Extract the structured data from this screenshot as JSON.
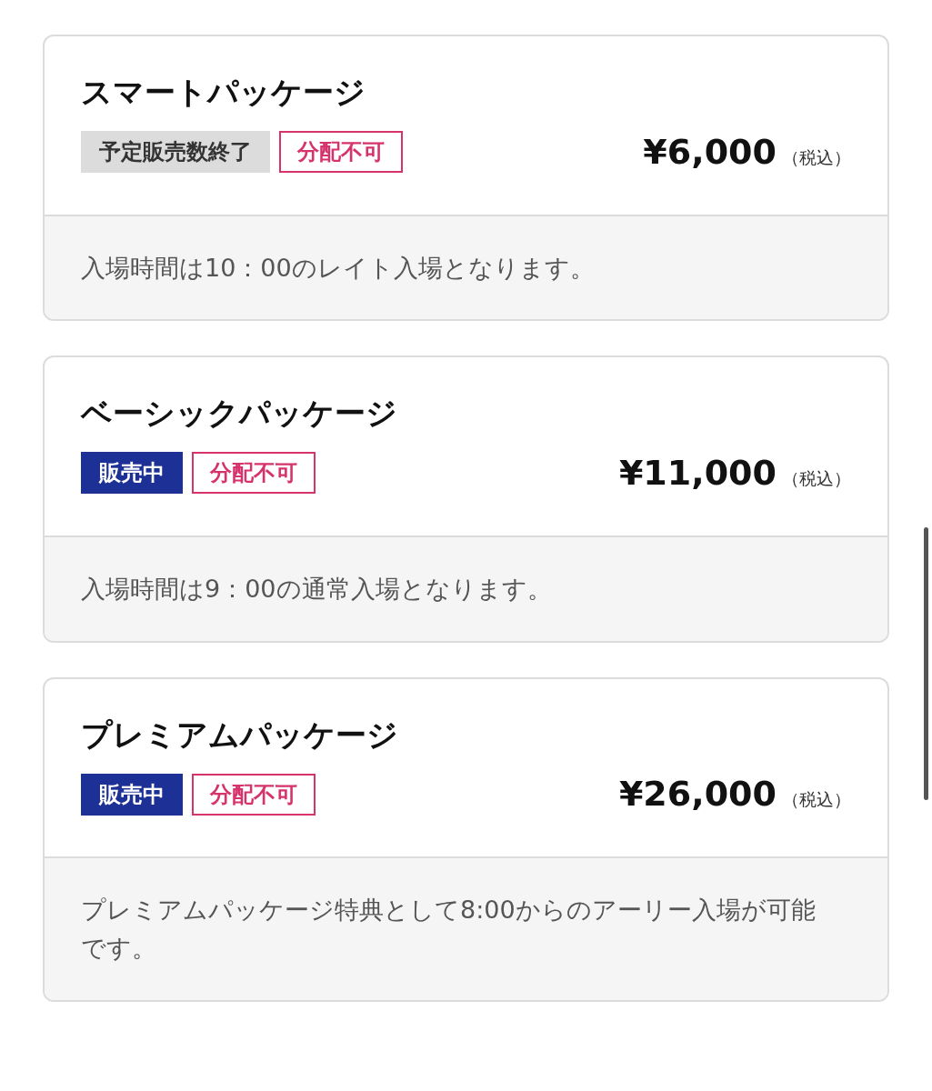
{
  "packages": [
    {
      "name": "スマートパッケージ",
      "badges": [
        {
          "kind": "sold_out",
          "label": "予定販売数終了"
        },
        {
          "kind": "restriction",
          "label": "分配不可"
        }
      ],
      "price": "¥6,000",
      "tax_note": "（税込）",
      "description": "入場時間は10：00のレイト入場となります。"
    },
    {
      "name": "ベーシックパッケージ",
      "badges": [
        {
          "kind": "on_sale",
          "label": "販売中"
        },
        {
          "kind": "restriction",
          "label": "分配不可"
        }
      ],
      "price": "¥11,000",
      "tax_note": "（税込）",
      "description": "入場時間は9：00の通常入場となります。"
    },
    {
      "name": "プレミアムパッケージ",
      "badges": [
        {
          "kind": "on_sale",
          "label": "販売中"
        },
        {
          "kind": "restriction",
          "label": "分配不可"
        }
      ],
      "price": "¥26,000",
      "tax_note": "（税込）",
      "description": "プレミアムパッケージ特典として8:00からのアーリー入場が可能です。"
    }
  ]
}
